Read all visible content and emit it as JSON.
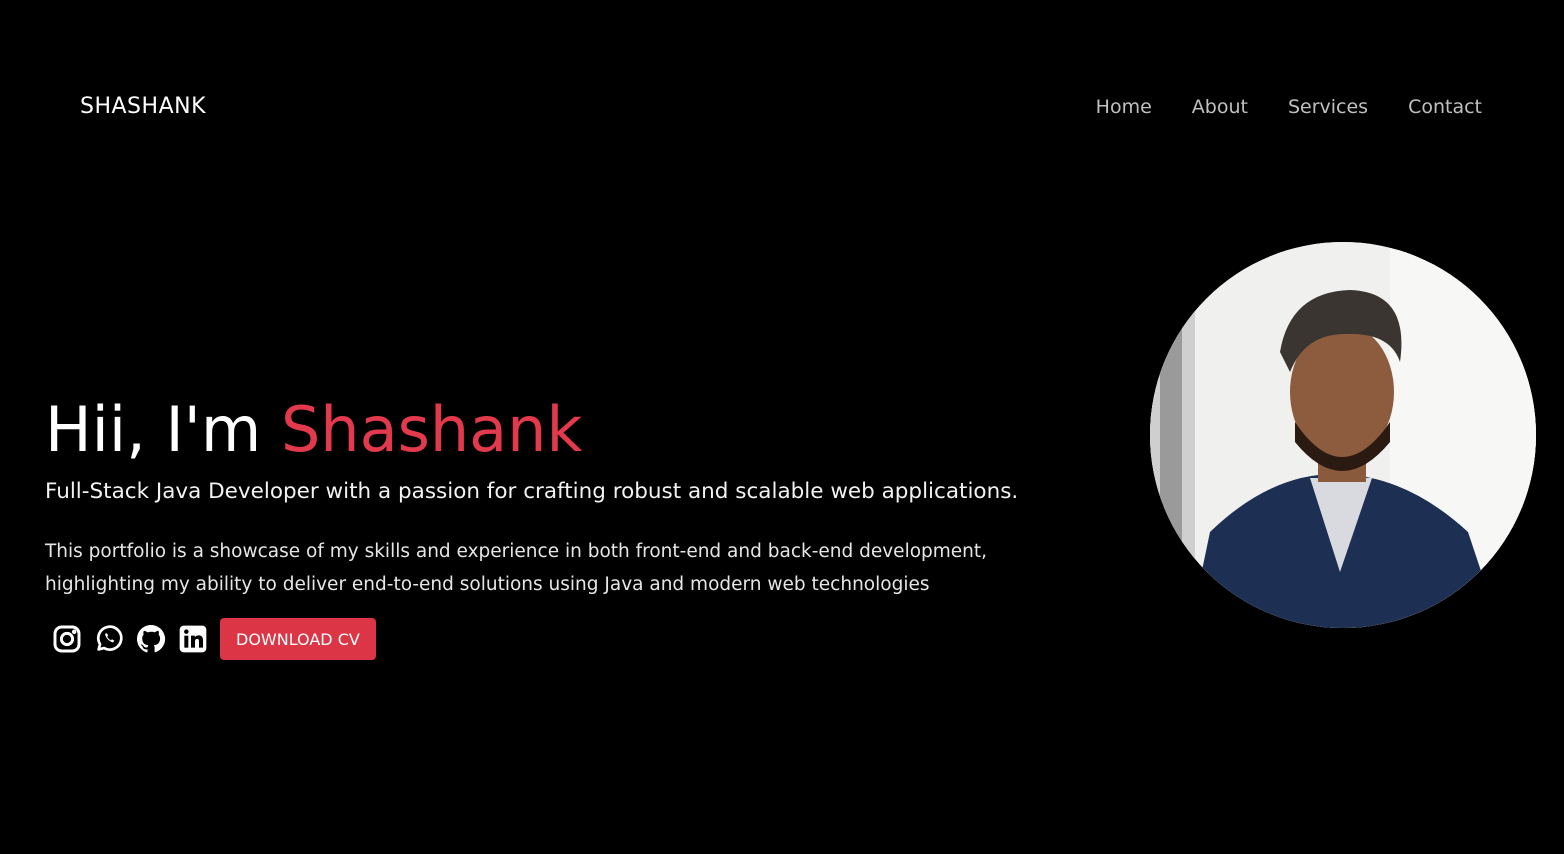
{
  "header": {
    "brand": "SHASHANK",
    "nav": [
      "Home",
      "About",
      "Services",
      "Contact"
    ]
  },
  "hero": {
    "greeting": "Hii, I'm",
    "name": "Shashank",
    "subtitle": "Full-Stack Java Developer with a passion for crafting robust and scalable web applications.",
    "description": "This portfolio is a showcase of my skills and experience in both front-end and back-end development, highlighting my ability to deliver end-to-end solutions using Java and modern web technologies",
    "cv_button": "DOWNLOAD CV"
  },
  "social_icons": [
    "instagram-icon",
    "whatsapp-icon",
    "github-icon",
    "linkedin-icon"
  ],
  "colors": {
    "background": "#000000",
    "accent": "#dc3545",
    "nav_text": "#c0c0c0"
  }
}
